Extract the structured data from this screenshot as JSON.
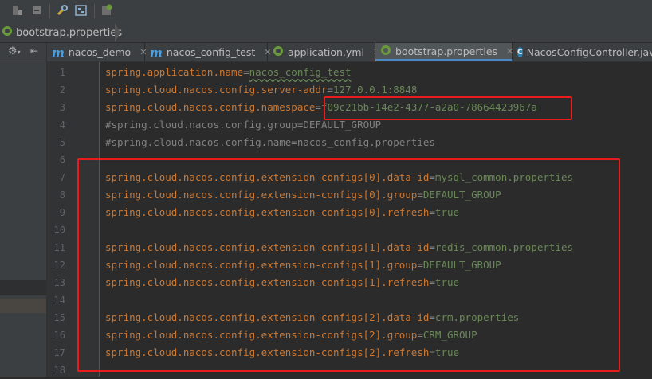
{
  "breadcrumb": {
    "file": "bootstrap.properties"
  },
  "tabs": [
    {
      "label": "nacos_demo",
      "icon": "module-icon"
    },
    {
      "label": "nacos_config_test",
      "icon": "module-icon"
    },
    {
      "label": "application.yml",
      "icon": "spring-leaf-icon"
    },
    {
      "label": "bootstrap.properties",
      "icon": "spring-leaf-icon",
      "active": true
    },
    {
      "label": "NacosConfigController.java",
      "icon": "class-icon"
    }
  ],
  "lines": [
    {
      "n": "1",
      "key": "spring.application.name",
      "eq": "=",
      "val": "nacos_config_test"
    },
    {
      "n": "2",
      "key": "spring.cloud.nacos.config.server-addr",
      "eq": "=",
      "val": "127.0.0.1:8848"
    },
    {
      "n": "3",
      "key": "spring.cloud.nacos.config.namespace",
      "eq": "=",
      "val": "f09c21bb-14e2-4377-a2a0-78664423967a"
    },
    {
      "n": "4",
      "comment": "#spring.cloud.nacos.config.group=DEFAULT_GROUP"
    },
    {
      "n": "5",
      "comment": "#spring.cloud.nacos.config.name=nacos_config.properties"
    },
    {
      "n": "6"
    },
    {
      "n": "7",
      "key": "spring.cloud.nacos.config.extension-configs[0].data-id",
      "eq": "=",
      "val": "mysql_common.properties"
    },
    {
      "n": "8",
      "key": "spring.cloud.nacos.config.extension-configs[0].group",
      "eq": "=",
      "val": "DEFAULT_GROUP"
    },
    {
      "n": "9",
      "key": "spring.cloud.nacos.config.extension-configs[0].refresh",
      "eq": "=",
      "val": "true"
    },
    {
      "n": "10"
    },
    {
      "n": "11",
      "key": "spring.cloud.nacos.config.extension-configs[1].data-id",
      "eq": "=",
      "val": "redis_common.properties"
    },
    {
      "n": "12",
      "key": "spring.cloud.nacos.config.extension-configs[1].group",
      "eq": "=",
      "val": "DEFAULT_GROUP"
    },
    {
      "n": "13",
      "key": "spring.cloud.nacos.config.extension-configs[1].refresh",
      "eq": "=",
      "val": "true"
    },
    {
      "n": "14"
    },
    {
      "n": "15",
      "key": "spring.cloud.nacos.config.extension-configs[2].data-id",
      "eq": "=",
      "val": "crm.properties"
    },
    {
      "n": "16",
      "key": "spring.cloud.nacos.config.extension-configs[2].group",
      "eq": "=",
      "val": "CRM_GROUP"
    },
    {
      "n": "17",
      "key": "spring.cloud.nacos.config.extension-configs[2].refresh",
      "eq": "=",
      "val": "true"
    },
    {
      "n": "18"
    }
  ],
  "colors": {
    "key": "#cc7832",
    "value": "#6a8759",
    "comment": "#808080",
    "highlight_box": "#e81c1c"
  }
}
